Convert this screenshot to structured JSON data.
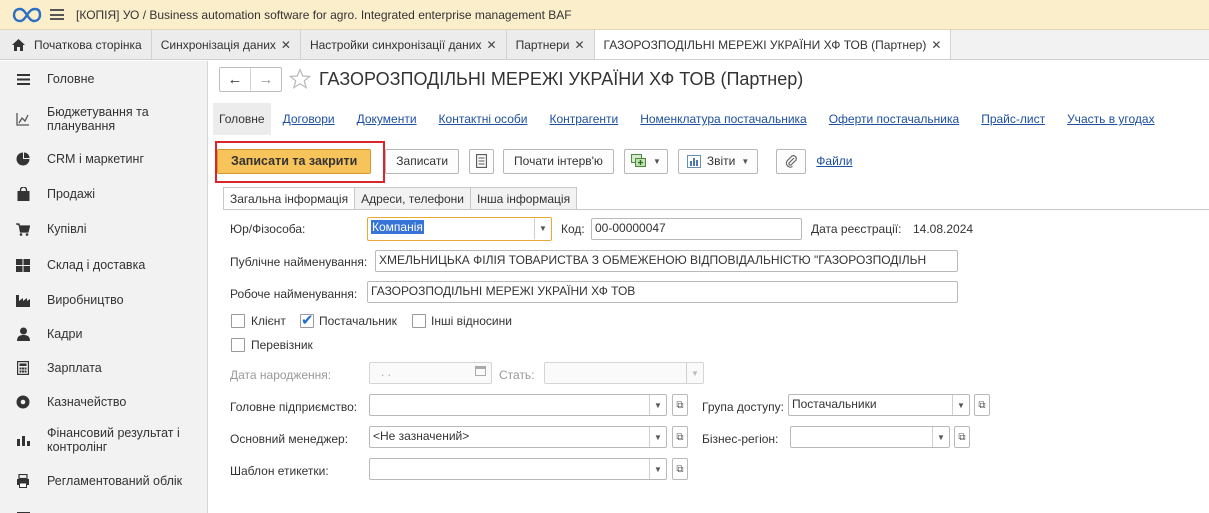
{
  "window": {
    "title": "[КОПІЯ] УО / Business automation software for agro. Integrated enterprise management BAF"
  },
  "tabs": [
    {
      "label": "Початкова сторінка"
    },
    {
      "label": "Синхронізація даних"
    },
    {
      "label": "Настройки синхронізації даних"
    },
    {
      "label": "Партнери"
    },
    {
      "label": "ГАЗОРОЗПОДІЛЬНІ МЕРЕЖІ УКРАЇНИ ХФ ТОВ (Партнер)"
    }
  ],
  "sidebar": {
    "items": [
      {
        "label": "Головне",
        "icon": "menu-lines-icon"
      },
      {
        "label": "Бюджетування та планування",
        "icon": "budget-chart-icon"
      },
      {
        "label": "CRM і маркетинг",
        "icon": "crm-pie-icon"
      },
      {
        "label": "Продажі",
        "icon": "shopping-bag-icon"
      },
      {
        "label": "Купівлі",
        "icon": "cart-icon"
      },
      {
        "label": "Склад і доставка",
        "icon": "warehouse-icon"
      },
      {
        "label": "Виробництво",
        "icon": "factory-icon"
      },
      {
        "label": "Кадри",
        "icon": "person-icon"
      },
      {
        "label": "Зарплата",
        "icon": "calculator-icon"
      },
      {
        "label": "Казначейство",
        "icon": "treasury-icon"
      },
      {
        "label": "Фінансовий результат і контролінг",
        "icon": "bar-chart-icon"
      },
      {
        "label": "Регламентований облік",
        "icon": "printer-icon"
      }
    ]
  },
  "document": {
    "title": "ГАЗОРОЗПОДІЛЬНІ МЕРЕЖІ УКРАЇНИ ХФ ТОВ (Партнер)",
    "subtabs": [
      "Головне",
      "Договори",
      "Документи",
      "Контактні особи",
      "Контрагенти",
      "Номенклатура постачальника",
      "Оферти постачальника",
      "Прайс-лист",
      "Участь в угодах"
    ]
  },
  "toolbar": {
    "save_close": "Записати та закрити",
    "save": "Записати",
    "start_interview": "Почати інтерв'ю",
    "reports": "Звіти",
    "files": "Файли"
  },
  "form_tabs": [
    "Загальна інформація",
    "Адреси, телефони",
    "Інша інформація"
  ],
  "form": {
    "legal_type_label": "Юр/Фізособа:",
    "legal_type_value": "Компанія",
    "code_label": "Код:",
    "code_value": "00-00000047",
    "reg_date_label": "Дата реєстрації:",
    "reg_date_value": "14.08.2024",
    "public_name_label": "Публічне найменування:",
    "public_name_value": "ХМЕЛЬНИЦЬКА ФІЛІЯ ТОВАРИСТВА З ОБМЕЖЕНОЮ ВІДПОВІДАЛЬНІСТЮ \"ГАЗОРОЗПОДІЛЬН",
    "work_name_label": "Робоче найменування:",
    "work_name_value": "ГАЗОРОЗПОДІЛЬНІ МЕРЕЖІ УКРАЇНИ ХФ ТОВ",
    "client_label": "Клієнт",
    "supplier_label": "Постачальник",
    "other_relations_label": "Інші відносини",
    "carrier_label": "Перевізник",
    "birth_date_label": "Дата народження:",
    "birth_date_value": ". .",
    "gender_label": "Стать:",
    "parent_company_label": "Головне підприємство:",
    "access_group_label": "Група доступу:",
    "access_group_value": "Постачальники",
    "main_manager_label": "Основний менеджер:",
    "main_manager_value": "<Не зазначений>",
    "business_region_label": "Бізнес-регіон:",
    "label_template_label": "Шаблон етикетки:"
  }
}
